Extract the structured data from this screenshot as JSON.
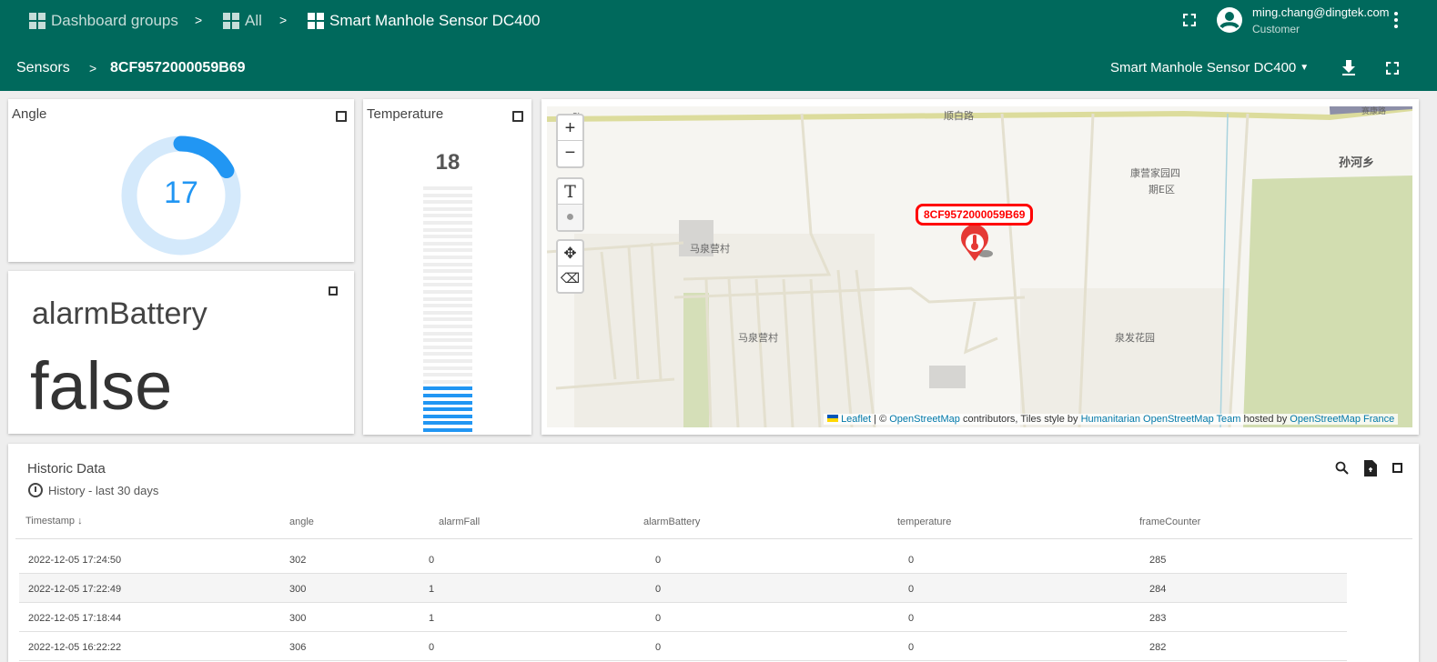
{
  "header": {
    "breadcrumbs": [
      {
        "label": "Dashboard groups",
        "icon": "dashboard-grid-icon"
      },
      {
        "label": "All",
        "icon": "dashboard-grid-icon"
      },
      {
        "label": "Smart Manhole Sensor DC400",
        "icon": "dashboard-grid-icon"
      }
    ],
    "separator": ">",
    "user_email": "ming.chang@dingtek.com",
    "user_role": "Customer",
    "sub_breadcrumb": {
      "parent": "Sensors",
      "current": "8CF9572000059B69"
    },
    "dashboard_select": "Smart Manhole Sensor DC400",
    "colors": {
      "primary": "#00695c",
      "accent": "#2196f3"
    }
  },
  "angle_widget": {
    "title": "Angle",
    "value": "17",
    "gauge_fraction": 0.17
  },
  "battery_widget": {
    "label": "alarmBattery",
    "value": "false"
  },
  "temperature_widget": {
    "title": "Temperature",
    "value": "18",
    "fill_fraction": 0.18
  },
  "map": {
    "marker_label": "8CF9572000059B69",
    "marker_icon": "thermometer-pin-icon",
    "place_labels": [
      "顺白路",
      "马泉营村",
      "马泉营村",
      "康营家园四",
      "期E区",
      "孙河乡",
      "泉发花园",
      "路",
      "赛康路"
    ],
    "attribution": {
      "leaflet": "Leaflet",
      "sep": " | © ",
      "osm": "OpenStreetMap",
      "text1": " contributors, Tiles style by ",
      "hot": "Humanitarian OpenStreetMap Team",
      "text2": " hosted by ",
      "osmfr": "OpenStreetMap France"
    }
  },
  "historic": {
    "title": "Historic Data",
    "timewindow": "History - last 30 days",
    "columns": [
      "Timestamp",
      "angle",
      "alarmFall",
      "alarmBattery",
      "temperature",
      "frameCounter"
    ],
    "rows": [
      [
        "2022-12-05 17:24:50",
        "302",
        "0",
        "0",
        "0",
        "285"
      ],
      [
        "2022-12-05 17:22:49",
        "300",
        "1",
        "0",
        "0",
        "284"
      ],
      [
        "2022-12-05 17:18:44",
        "300",
        "1",
        "0",
        "0",
        "283"
      ],
      [
        "2022-12-05 16:22:22",
        "306",
        "0",
        "0",
        "0",
        "282"
      ]
    ]
  }
}
